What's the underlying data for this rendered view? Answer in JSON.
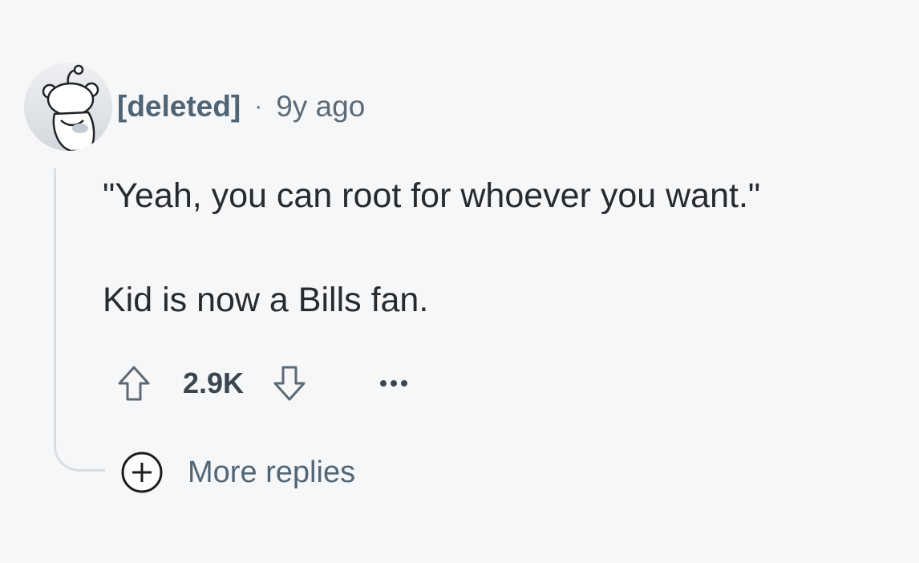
{
  "comment": {
    "author": "[deleted]",
    "separator": "·",
    "time_ago": "9y ago",
    "avatar_icon": "reddit-snoo-avatar",
    "body_lines": [
      "\"Yeah, you can root for whoever you want.\"",
      "Kid is now a Bills fan."
    ],
    "score": "2.9K",
    "upvote_icon": "arrow-up-icon",
    "downvote_icon": "arrow-down-icon",
    "overflow_icon": "ellipsis-icon"
  },
  "replies": {
    "icon": "plus-circle-icon",
    "label": "More replies"
  },
  "colors": {
    "background": "#f6f7f9",
    "author": "#4f6474",
    "meta": "#5c6b77",
    "body_text": "#262b2f",
    "score": "#3b4651",
    "thread_line": "#d9dee3"
  }
}
